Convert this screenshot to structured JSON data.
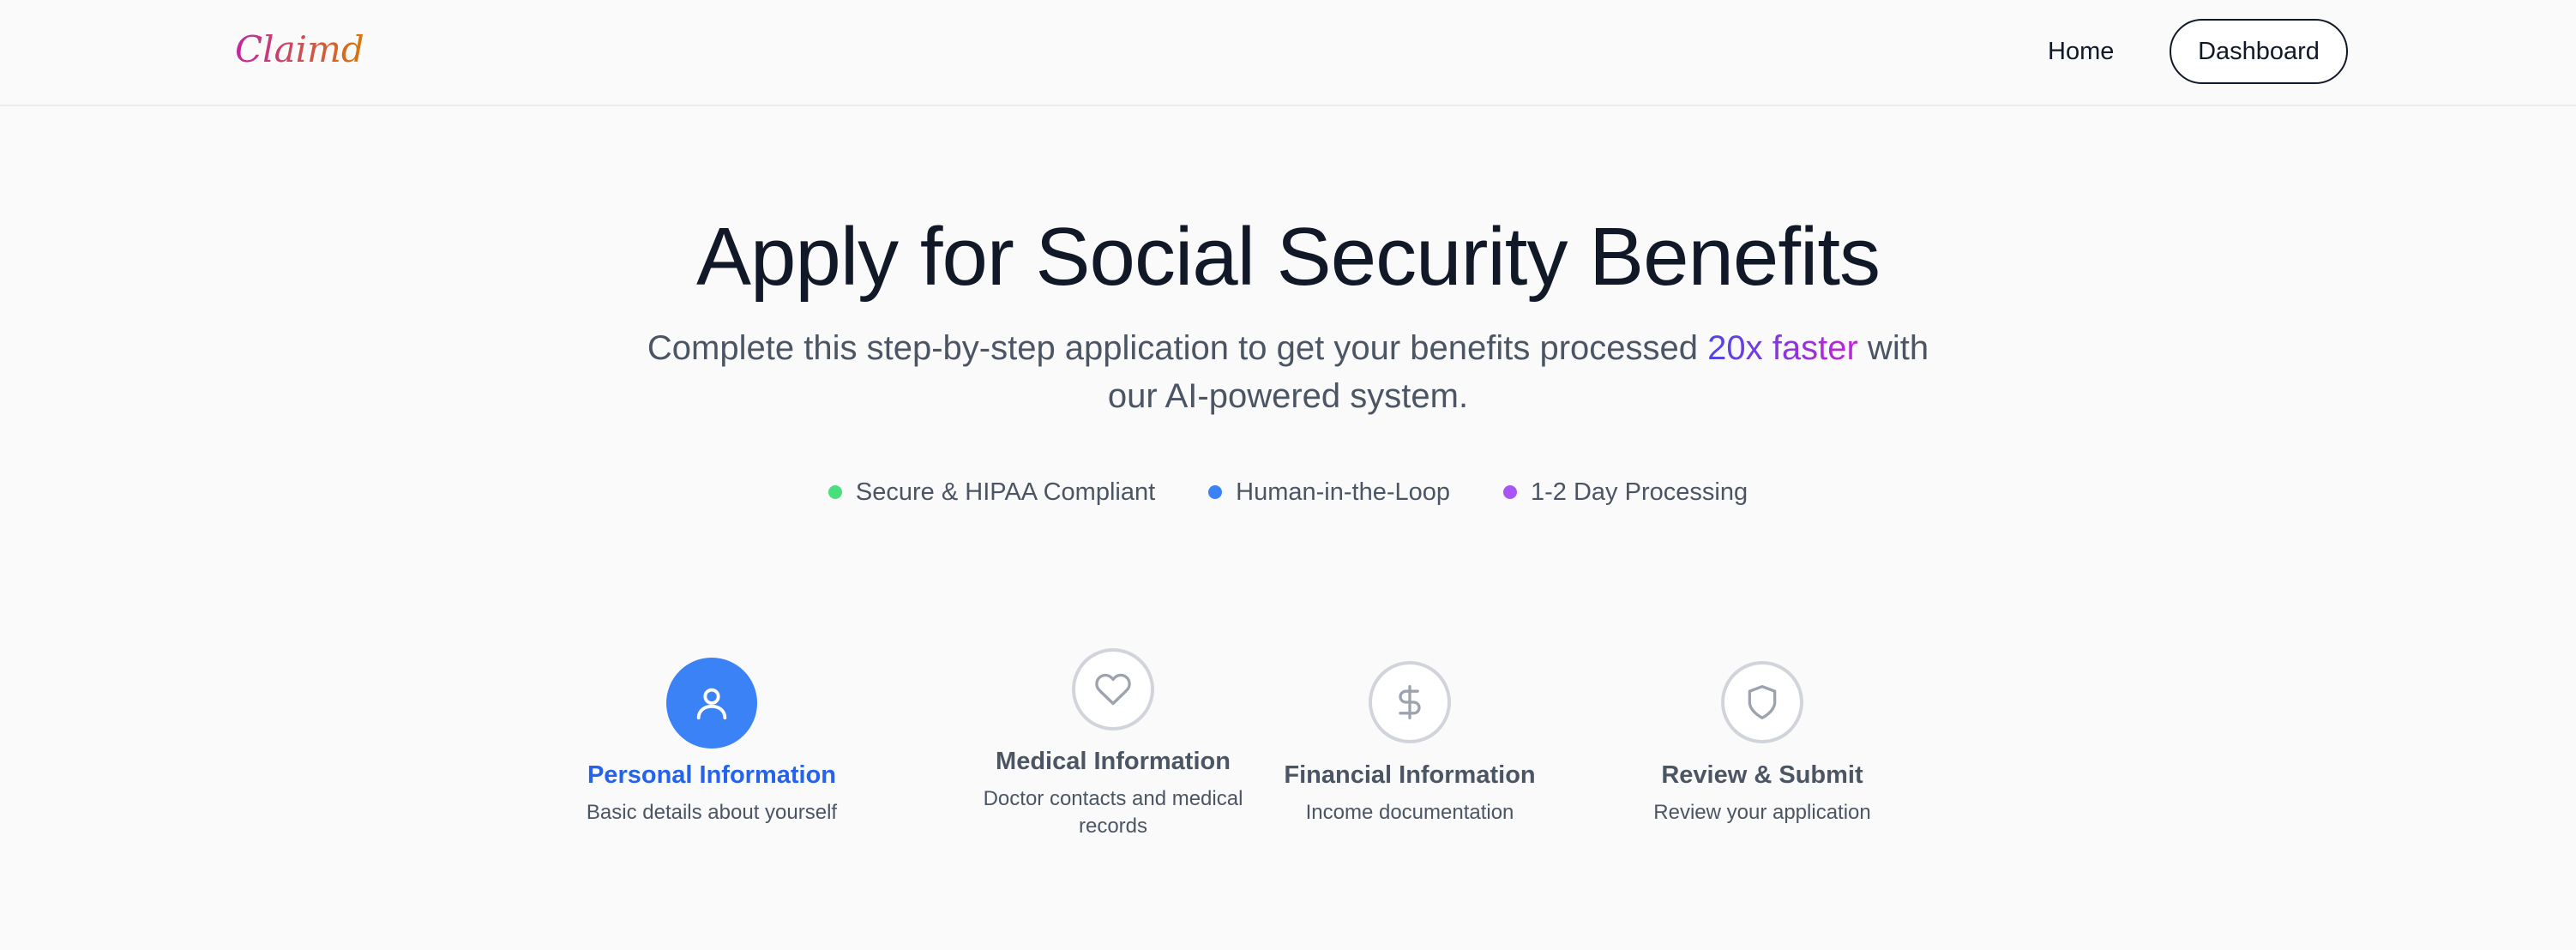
{
  "header": {
    "logo": "Claimd",
    "nav": {
      "home": "Home",
      "dashboard": "Dashboard"
    }
  },
  "hero": {
    "title": "Apply for Social Security Benefits",
    "subtitle_before": "Complete this step-by-step application to get your benefits processed ",
    "subtitle_accent": "20x faster",
    "subtitle_after": " with our AI-powered system."
  },
  "features": [
    {
      "label": "Secure & HIPAA Compliant",
      "color": "#4ade80"
    },
    {
      "label": "Human-in-the-Loop",
      "color": "#3b82f6"
    },
    {
      "label": "1-2 Day Processing",
      "color": "#a855f7"
    }
  ],
  "steps": [
    {
      "title": "Personal Information",
      "description": "Basic details about yourself",
      "icon": "user-icon",
      "state": "active"
    },
    {
      "title": "Medical Information",
      "description": "Doctor contacts and medical records",
      "icon": "heart-icon",
      "state": "pending"
    },
    {
      "title": "Financial Information",
      "description": "Income documentation",
      "icon": "dollar-icon",
      "state": "pending"
    },
    {
      "title": "Review & Submit",
      "description": "Review your application",
      "icon": "shield-icon",
      "state": "pending"
    }
  ],
  "colors": {
    "accent": "#3b82f6",
    "accent_text": "#2563eb",
    "logo_gradient": [
      "#c026a3",
      "#d97706"
    ],
    "subtitle_gradient": [
      "#4f46e5",
      "#c026d3"
    ]
  }
}
